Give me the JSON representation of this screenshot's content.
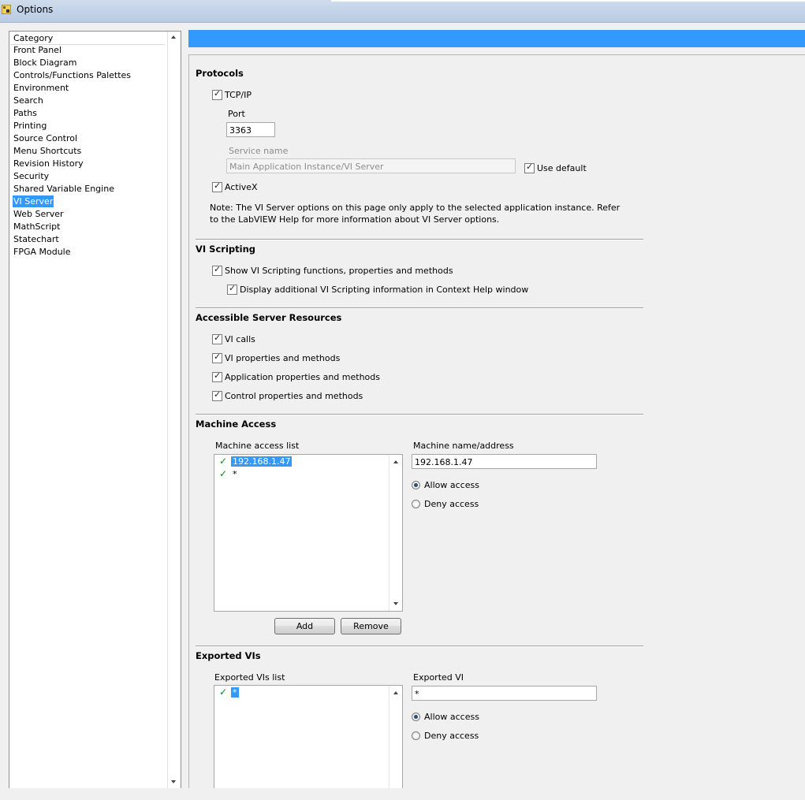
{
  "window": {
    "title": "Options",
    "icon": "labview-options-icon"
  },
  "category": {
    "header": "Category",
    "items": [
      "Front Panel",
      "Block Diagram",
      "Controls/Functions Palettes",
      "Environment",
      "Search",
      "Paths",
      "Printing",
      "Source Control",
      "Menu Shortcuts",
      "Revision History",
      "Security",
      "Shared Variable Engine",
      "VI Server",
      "Web Server",
      "MathScript",
      "Statechart",
      "FPGA Module"
    ],
    "selected": "VI Server"
  },
  "protocols": {
    "title": "Protocols",
    "tcpip": {
      "label": "TCP/IP",
      "checked": true
    },
    "port_label": "Port",
    "port_value": "3363",
    "service_label": "Service name",
    "service_value": "Main Application Instance/VI Server",
    "use_default": {
      "label": "Use default",
      "checked": true
    },
    "activex": {
      "label": "ActiveX",
      "checked": true
    },
    "note_line1": "Note: The VI Server options on this page only apply to the selected application instance. Refer",
    "note_line2": "to the LabVIEW Help for more information about VI Server options."
  },
  "scripting": {
    "title": "VI Scripting",
    "show": {
      "label": "Show VI Scripting functions, properties and methods",
      "checked": true
    },
    "display": {
      "label": "Display additional VI Scripting information in Context Help window",
      "checked": true
    }
  },
  "resources": {
    "title": "Accessible Server Resources",
    "items": [
      {
        "label": "VI calls",
        "checked": true
      },
      {
        "label": "VI properties and methods",
        "checked": true
      },
      {
        "label": "Application properties and methods",
        "checked": true
      },
      {
        "label": "Control properties and methods",
        "checked": true
      }
    ]
  },
  "machine": {
    "title": "Machine Access",
    "list_label": "Machine access list",
    "entries": [
      "192.168.1.47",
      "*"
    ],
    "name_label": "Machine name/address",
    "name_value": "192.168.1.47",
    "allow": "Allow access",
    "deny": "Deny access",
    "add": "Add",
    "remove": "Remove"
  },
  "exported": {
    "title": "Exported VIs",
    "list_label": "Exported VIs list",
    "entries": [
      "*"
    ],
    "vi_label": "Exported VI",
    "vi_value": "*",
    "allow": "Allow access",
    "deny": "Deny access"
  }
}
